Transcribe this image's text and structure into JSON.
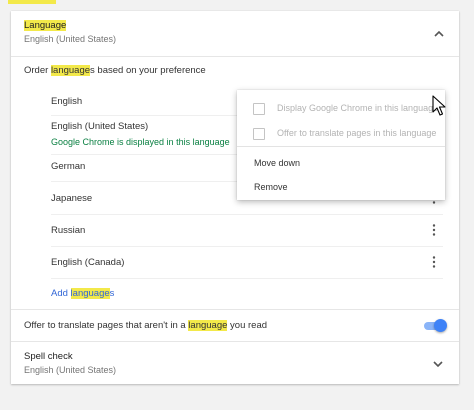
{
  "language_section": {
    "title": "Language",
    "subtitle": "English (United States)",
    "order_label_prefix": "Order ",
    "order_label_highlight": "language",
    "order_label_suffix": "s based on your preference",
    "languages": [
      {
        "name": "English"
      },
      {
        "name": "English (United States)",
        "note": "Google Chrome is displayed in this language"
      },
      {
        "name": "German"
      },
      {
        "name": "Japanese"
      },
      {
        "name": "Russian"
      },
      {
        "name": "English (Canada)"
      }
    ],
    "add_prefix": "Add ",
    "add_highlight": "language",
    "add_suffix": "s",
    "offer_prefix": "Offer to translate pages that aren't in a ",
    "offer_highlight": "language",
    "offer_suffix": " you read",
    "offer_enabled": true
  },
  "context_menu": {
    "display_label": "Display Google Chrome in this language",
    "offer_label": "Offer to translate pages in this language",
    "move_down": "Move down",
    "remove": "Remove"
  },
  "spell_check": {
    "title": "Spell check",
    "subtitle": "English (United States)"
  },
  "icons": {
    "expand": "chevron-up-icon",
    "collapse": "chevron-down-icon",
    "more": "more-vert-icon"
  },
  "colors": {
    "highlight": "#f3e94a",
    "link": "#3367d6",
    "note": "#0b8043",
    "toggle": "#3e82f7"
  }
}
